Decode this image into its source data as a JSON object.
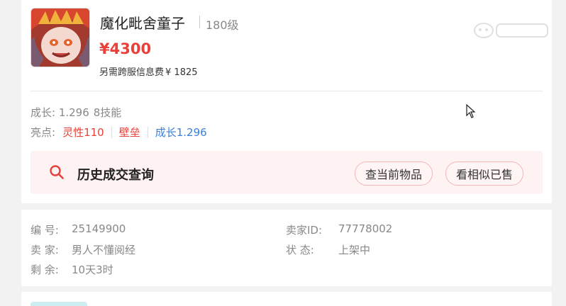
{
  "pet": {
    "name": "魔化毗舍童子",
    "level": "180级",
    "price": "¥4300",
    "fee_label": "另需跨服信息费",
    "fee_amount": "¥ 1825"
  },
  "growth": {
    "text": "成长: 1.296",
    "skills": "8技能"
  },
  "highlights": {
    "label": "亮点:",
    "tags": [
      {
        "text": "灵性110",
        "color": "#e8403a"
      },
      {
        "text": "壁垒",
        "color": "#e8403a"
      },
      {
        "text": "成长1.296",
        "color": "#3a7fd9"
      }
    ]
  },
  "history": {
    "title": "历史成交查询",
    "current_button": "查当前物品",
    "similar_button": "看相似已售"
  },
  "info": {
    "id_label": "编  号:",
    "id_value": "25149900",
    "seller_id_label": "卖家ID:",
    "seller_id_value": "77778002",
    "seller_label": "卖  家:",
    "seller_value": "男人不懂阅经",
    "status_label": "状  态:",
    "status_value": "上架中",
    "remaining_label": "剩  余:",
    "remaining_value": "10天3时"
  },
  "colors": {
    "accent": "#e8403a",
    "link_blue": "#3a7fd9",
    "history_bg": "#fff2f2"
  },
  "icons": [
    "search-icon",
    "pet-avatar",
    "mouse-cursor",
    "watermark-logo"
  ]
}
